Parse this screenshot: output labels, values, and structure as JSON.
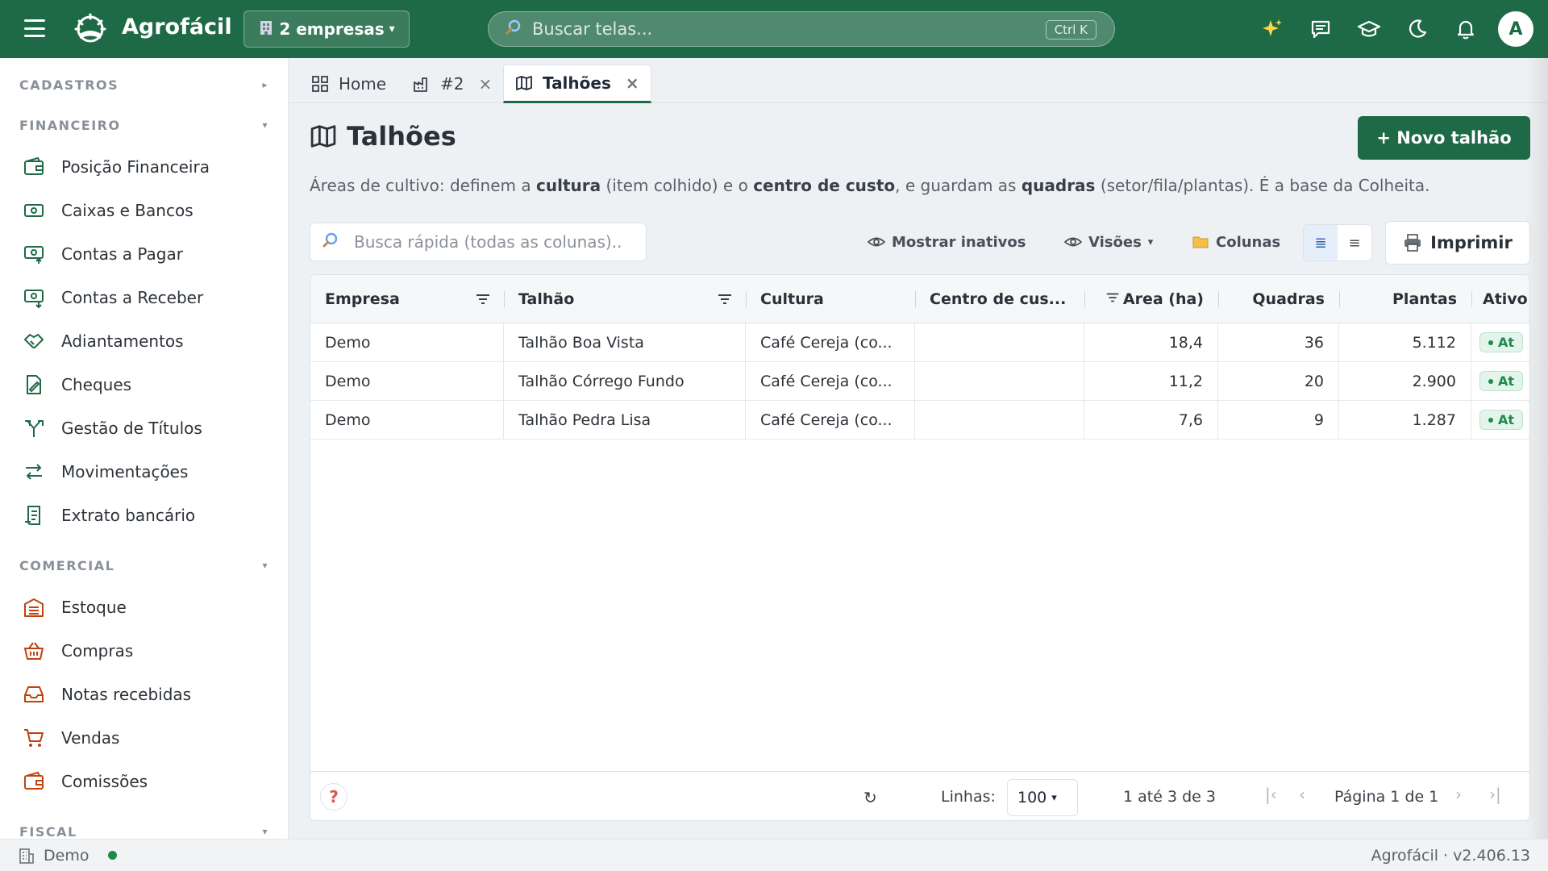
{
  "app": {
    "name": "Agrofácil"
  },
  "topbar": {
    "company_selector": "2 empresas",
    "search_placeholder": "Buscar telas...",
    "search_shortcut": "Ctrl K",
    "avatar_initial": "A",
    "icons": [
      "sparkles-icon",
      "chat-icon",
      "graduation-cap-icon",
      "moon-icon",
      "bell-icon"
    ]
  },
  "sidebar": {
    "sections": [
      {
        "title": "CADASTROS",
        "expanded": false,
        "items": []
      },
      {
        "title": "FINANCEIRO",
        "expanded": true,
        "items": [
          {
            "label": "Posição Financeira",
            "icon": "wallet-icon"
          },
          {
            "label": "Caixas e Bancos",
            "icon": "cash-icon"
          },
          {
            "label": "Contas a Pagar",
            "icon": "cash-out-icon"
          },
          {
            "label": "Contas a Receber",
            "icon": "cash-in-icon"
          },
          {
            "label": "Adiantamentos",
            "icon": "handshake-icon"
          },
          {
            "label": "Cheques",
            "icon": "cheque-icon"
          },
          {
            "label": "Gestão de Títulos",
            "icon": "split-icon"
          },
          {
            "label": "Movimentações",
            "icon": "transfer-icon"
          },
          {
            "label": "Extrato bancário",
            "icon": "receipt-icon"
          }
        ]
      },
      {
        "title": "COMERCIAL",
        "expanded": true,
        "items": [
          {
            "label": "Estoque",
            "icon": "warehouse-icon"
          },
          {
            "label": "Compras",
            "icon": "basket-icon"
          },
          {
            "label": "Notas recebidas",
            "icon": "inbox-icon"
          },
          {
            "label": "Vendas",
            "icon": "cart-icon"
          },
          {
            "label": "Comissões",
            "icon": "wallet-icon"
          }
        ]
      },
      {
        "title": "FISCAL",
        "expanded": true,
        "items": []
      }
    ],
    "accent_financeiro": "#1f6a46",
    "accent_comercial": "#c2410c"
  },
  "tabs": [
    {
      "label": "Home",
      "icon": "grid-icon",
      "closable": false,
      "active": false
    },
    {
      "label": "#2",
      "icon": "factory-icon",
      "closable": true,
      "active": false
    },
    {
      "label": "Talhões",
      "icon": "map-icon",
      "closable": true,
      "active": true
    }
  ],
  "page": {
    "title": "Talhões",
    "new_button": "+ Novo talhão",
    "description": {
      "p1": "Áreas de cultivo: definem a ",
      "b1": "cultura",
      "p2": " (item colhido) e o ",
      "b2": "centro de custo",
      "p3": ", e guardam as ",
      "b3": "quadras",
      "p4": " (setor/fila/plantas). É a base da Colheita."
    }
  },
  "toolbar": {
    "quick_search_placeholder": "Busca rápida (todas as colunas)..",
    "show_inactive": "Mostrar inativos",
    "views": "Visões",
    "columns": "Colunas",
    "print": "Imprimir"
  },
  "grid": {
    "columns": [
      "Empresa",
      "Talhão",
      "Cultura",
      "Centro de cus...",
      "Area (ha)",
      "Quadras",
      "Plantas",
      "Ativo"
    ],
    "rows": [
      {
        "empresa": "Demo",
        "talhao": "Talhão Boa Vista",
        "cultura": "Café Cereja (co...",
        "centro": "",
        "area": "18,4",
        "quadras": "36",
        "plantas": "5.112",
        "ativo": "At"
      },
      {
        "empresa": "Demo",
        "talhao": "Talhão Córrego Fundo",
        "cultura": "Café Cereja (co...",
        "centro": "",
        "area": "11,2",
        "quadras": "20",
        "plantas": "2.900",
        "ativo": "At"
      },
      {
        "empresa": "Demo",
        "talhao": "Talhão Pedra Lisa",
        "cultura": "Café Cereja (co...",
        "centro": "",
        "area": "7,6",
        "quadras": "9",
        "plantas": "1.287",
        "ativo": "At"
      }
    ],
    "footer": {
      "help": "?",
      "refresh": "↻",
      "rows_label": "Linhas:",
      "rows_value": "100",
      "range": "1 até 3 de 3",
      "page": "Página 1 de 1"
    }
  },
  "statusbar": {
    "company": "Demo",
    "version": "Agrofácil · v2.406.13"
  },
  "colors": {
    "brand": "#1f6a46",
    "status_ok": "#1f8a4c"
  }
}
